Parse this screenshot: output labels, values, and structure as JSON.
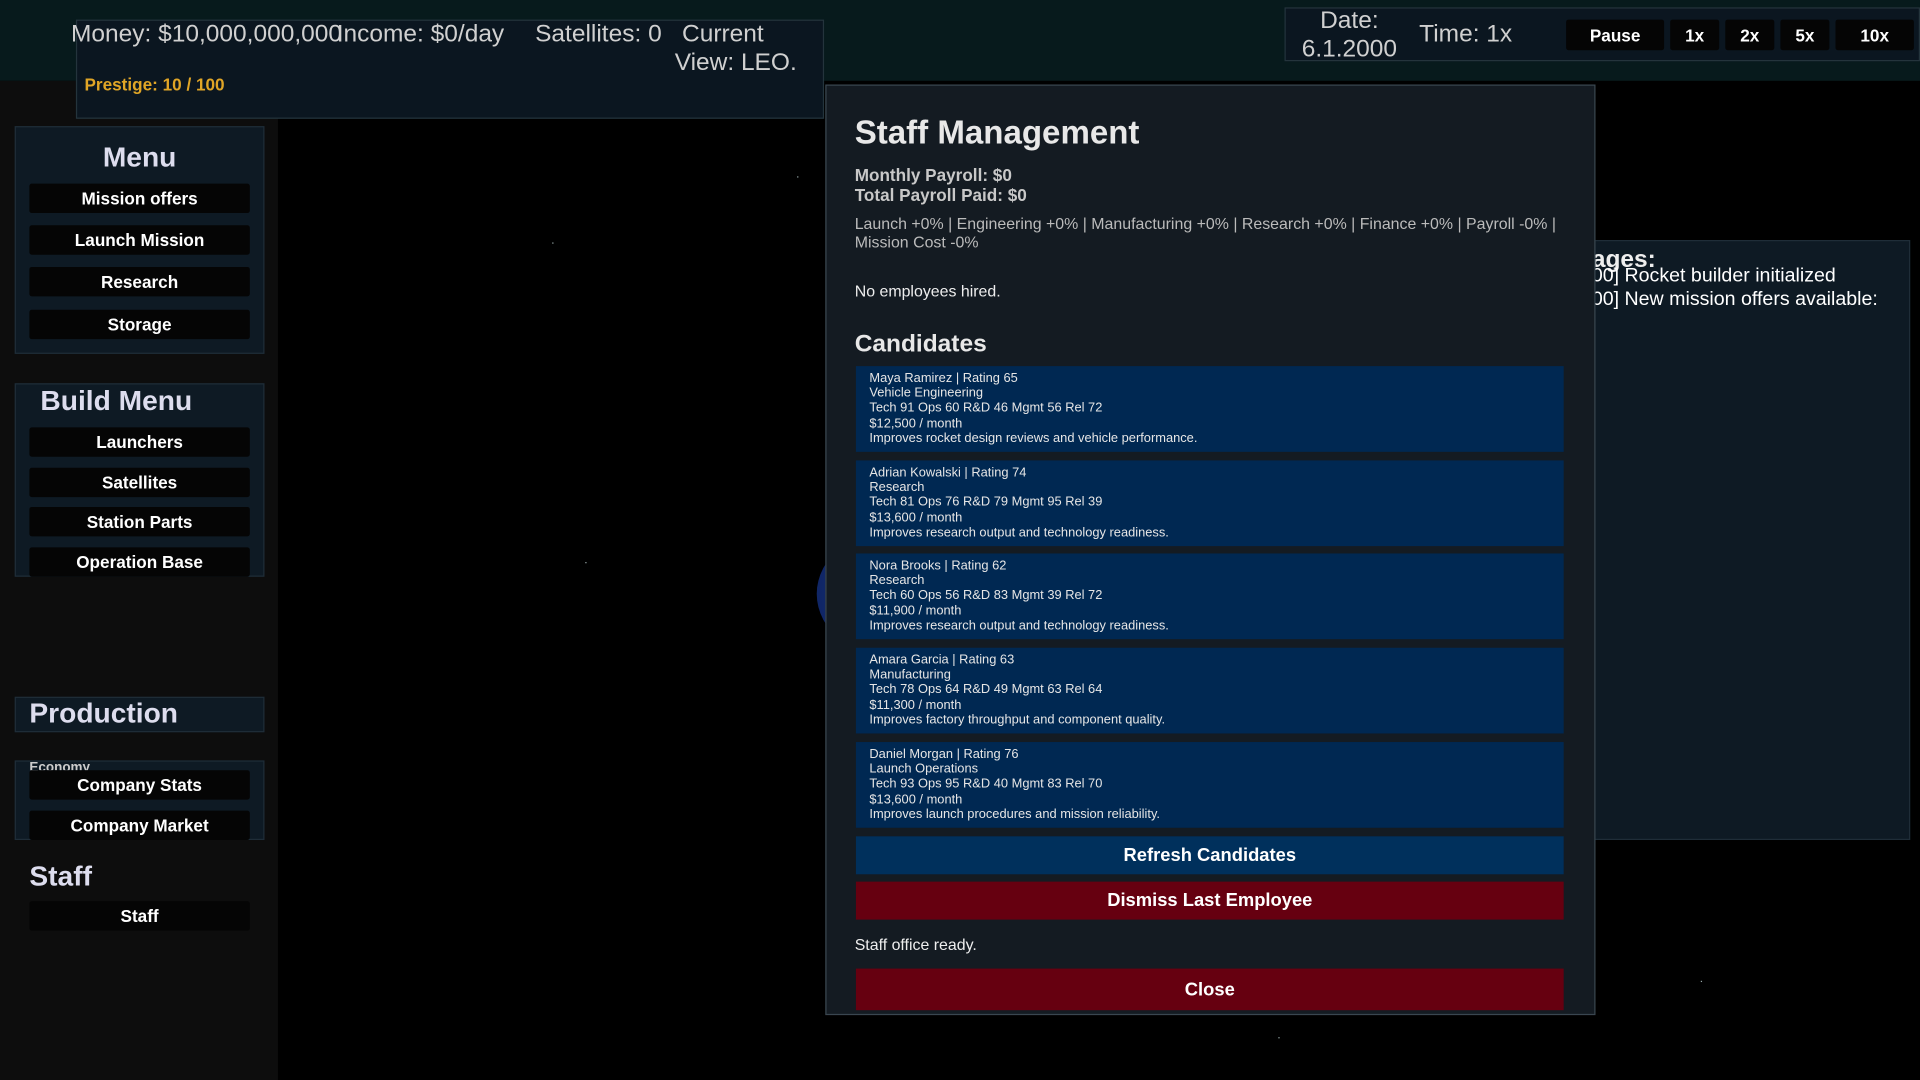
{
  "status": {
    "money": "Money: $10,000,000,000",
    "income": "Income: $0/day",
    "satellites": "Satellites: 0",
    "view_line1": "Current",
    "view_line2": "View: LEO.",
    "prestige": "Prestige: 10 / 100"
  },
  "time": {
    "date_line1": "Date:",
    "date_line2": "6.1.2000",
    "time_label": "Time: 1x",
    "pause": "Pause",
    "speed_1x": "1x",
    "speed_2x": "2x",
    "speed_5x": "5x",
    "speed_10x": "10x"
  },
  "menu": {
    "title": "Menu",
    "mission_offers": "Mission offers",
    "launch_mission": "Launch Mission",
    "research": "Research",
    "storage": "Storage"
  },
  "build_menu": {
    "title": "Build Menu",
    "launchers": "Launchers",
    "satellites": "Satellites",
    "station_parts": "Station Parts",
    "operation_base": "Operation Base"
  },
  "production": {
    "title": "Production"
  },
  "economy": {
    "label": "Economy",
    "company_stats": "Company Stats",
    "company_market": "Company Market"
  },
  "staff_section": {
    "title": "Staff",
    "staff_button": "Staff"
  },
  "messages": {
    "title_fragment": "ages:",
    "line1": "00] Rocket builder initialized",
    "line2": "00] New mission offers available:"
  },
  "modal": {
    "title": "Staff Management",
    "monthly_payroll": "Monthly Payroll: $0",
    "total_payroll": "Total Payroll Paid: $0",
    "modifiers": "Launch +0% | Engineering +0% | Manufacturing +0% | Research +0% | Finance +0% | Payroll -0% | Mission Cost -0%",
    "no_employees": "No employees hired.",
    "candidates_title": "Candidates",
    "candidates": [
      {
        "header": "Maya Ramirez  |  Rating 65",
        "role": "Vehicle Engineering",
        "stats": "Tech 91  Ops 60  R&D 46  Mgmt 56  Rel 72",
        "salary": "$12,500 / month",
        "desc": "Improves rocket design reviews and vehicle performance."
      },
      {
        "header": "Adrian Kowalski  |  Rating 74",
        "role": "Research",
        "stats": "Tech 81  Ops 76  R&D 79  Mgmt 95  Rel 39",
        "salary": "$13,600 / month",
        "desc": "Improves research output and technology readiness."
      },
      {
        "header": "Nora Brooks  |  Rating 62",
        "role": "Research",
        "stats": "Tech 60  Ops 56  R&D 83  Mgmt 39  Rel 72",
        "salary": "$11,900 / month",
        "desc": "Improves research output and technology readiness."
      },
      {
        "header": "Amara Garcia  |  Rating 63",
        "role": "Manufacturing",
        "stats": "Tech 78  Ops 64  R&D 49  Mgmt 63  Rel 64",
        "salary": "$11,300 / month",
        "desc": "Improves factory throughput and component quality."
      },
      {
        "header": "Daniel Morgan  |  Rating 76",
        "role": "Launch Operations",
        "stats": "Tech 93  Ops 95  R&D 40  Mgmt 83  Rel 70",
        "salary": "$13,600 / month",
        "desc": "Improves launch procedures and mission reliability."
      }
    ],
    "refresh": "Refresh Candidates",
    "dismiss": "Dismiss Last Employee",
    "status": "Staff office ready.",
    "close": "Close"
  },
  "colors": {
    "card_bg": "#002852",
    "refresh_bg": "#00305c",
    "danger_bg": "#660010",
    "prestige": "#e0a526"
  }
}
